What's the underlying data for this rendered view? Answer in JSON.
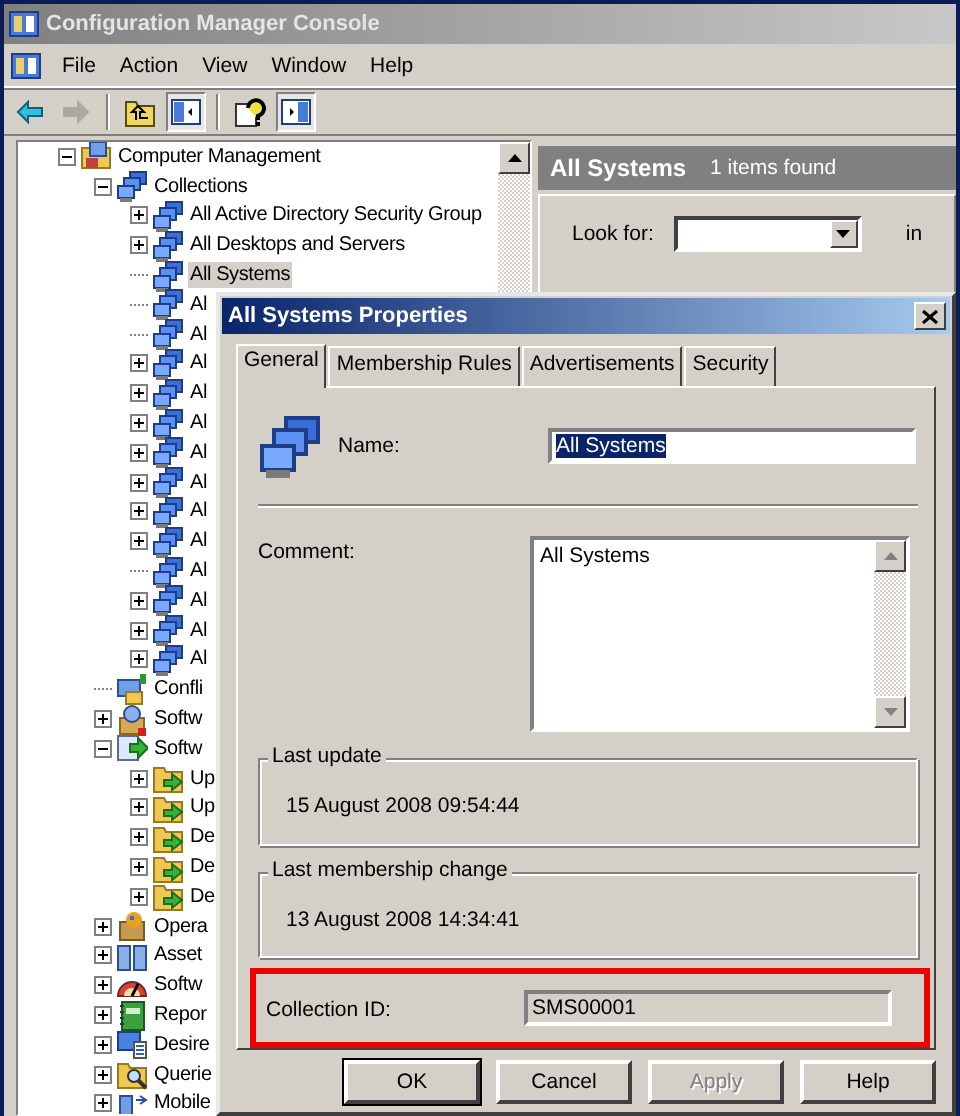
{
  "window": {
    "title": "Configuration Manager Console"
  },
  "menu": [
    "File",
    "Action",
    "View",
    "Window",
    "Help"
  ],
  "toolbar": [
    {
      "kind": "back",
      "disabled": false,
      "pressed": false
    },
    {
      "kind": "forward",
      "disabled": true,
      "pressed": false
    },
    {
      "kind": "separator"
    },
    {
      "kind": "up",
      "disabled": false,
      "pressed": false
    },
    {
      "kind": "tree",
      "disabled": false,
      "pressed": true
    },
    {
      "kind": "separator"
    },
    {
      "kind": "help",
      "disabled": false,
      "pressed": false
    },
    {
      "kind": "pane",
      "disabled": false,
      "pressed": true
    }
  ],
  "tree": [
    {
      "label": "Computer Management",
      "kind": "console",
      "expanded": true,
      "selected": false,
      "children": [
        {
          "label": "Collections",
          "kind": "collections",
          "expanded": true,
          "selected": false,
          "children": [
            {
              "label": "All Active Directory Security Group",
              "kind": "collection",
              "expanded": false,
              "selected": false
            },
            {
              "label": "All Desktops and Servers",
              "kind": "collection",
              "expanded": false,
              "selected": false
            },
            {
              "label": "All Systems",
              "kind": "collection",
              "selected": true
            },
            {
              "label": "Al",
              "kind": "collection",
              "selected": false
            },
            {
              "label": "Al",
              "kind": "collection",
              "selected": false
            },
            {
              "label": "Al",
              "kind": "collection",
              "expanded": false,
              "selected": false
            },
            {
              "label": "Al",
              "kind": "collection",
              "expanded": false,
              "selected": false
            },
            {
              "label": "Al",
              "kind": "collection",
              "expanded": false,
              "selected": false
            },
            {
              "label": "Al",
              "kind": "collection",
              "expanded": false,
              "selected": false
            },
            {
              "label": "Al",
              "kind": "collection",
              "expanded": false,
              "selected": false
            },
            {
              "label": "Al",
              "kind": "collection",
              "expanded": false,
              "selected": false
            },
            {
              "label": "Al",
              "kind": "collection",
              "expanded": false,
              "selected": false
            },
            {
              "label": "Al",
              "kind": "collection",
              "selected": false
            },
            {
              "label": "Al",
              "kind": "collection",
              "expanded": false,
              "selected": false
            },
            {
              "label": "Al",
              "kind": "collection",
              "expanded": false,
              "selected": false
            },
            {
              "label": "Al",
              "kind": "collection",
              "expanded": false,
              "selected": false
            }
          ]
        },
        {
          "label": "Confli",
          "kind": "conflict",
          "selected": false
        },
        {
          "label": "Softw",
          "kind": "package",
          "expanded": false,
          "selected": false
        },
        {
          "label": "Softw",
          "kind": "updates",
          "expanded": true,
          "selected": false,
          "children": [
            {
              "label": "Up",
              "kind": "folder",
              "expanded": false,
              "selected": false
            },
            {
              "label": "Up",
              "kind": "folder",
              "expanded": false,
              "selected": false
            },
            {
              "label": "De",
              "kind": "folder",
              "expanded": false,
              "selected": false
            },
            {
              "label": "De",
              "kind": "folder",
              "expanded": false,
              "selected": false
            },
            {
              "label": "De",
              "kind": "folder",
              "expanded": false,
              "selected": false
            }
          ]
        },
        {
          "label": "Opera",
          "kind": "os",
          "expanded": false,
          "selected": false
        },
        {
          "label": "Asset",
          "kind": "asset",
          "expanded": false,
          "selected": false
        },
        {
          "label": "Softw",
          "kind": "meter",
          "expanded": false,
          "selected": false
        },
        {
          "label": "Repor",
          "kind": "report",
          "expanded": false,
          "selected": false
        },
        {
          "label": "Desire",
          "kind": "desired",
          "expanded": false,
          "selected": false
        },
        {
          "label": "Querie",
          "kind": "query",
          "expanded": false,
          "selected": false
        },
        {
          "label": "Mobile",
          "kind": "mobile",
          "expanded": false,
          "selected": false
        }
      ]
    }
  ],
  "results_header": {
    "title": "All Systems",
    "count": "1 items found"
  },
  "search": {
    "label": "Look for:",
    "in_label": "in"
  },
  "dialog": {
    "title": "All Systems Properties",
    "tabs": [
      {
        "label": "General",
        "selected": true
      },
      {
        "label": "Membership Rules",
        "selected": false
      },
      {
        "label": "Advertisements",
        "selected": false
      },
      {
        "label": "Security",
        "selected": false
      }
    ],
    "name": {
      "label": "Name:",
      "value": "All Systems",
      "text_selected": true
    },
    "comment": {
      "label": "Comment:",
      "value": "All Systems"
    },
    "groups": [
      {
        "title": "Last update",
        "value": "15 August 2008 09:54:44"
      },
      {
        "title": "Last membership change",
        "value": "13 August 2008 14:34:41"
      }
    ],
    "collection_id": {
      "label": "Collection ID:",
      "value": "SMS00001",
      "highlighted": true
    },
    "buttons": [
      {
        "label": "OK",
        "default": true,
        "disabled": false
      },
      {
        "label": "Cancel",
        "default": false,
        "disabled": false
      },
      {
        "label": "Apply",
        "default": false,
        "disabled": true
      },
      {
        "label": "Help",
        "default": false,
        "disabled": false
      }
    ]
  }
}
